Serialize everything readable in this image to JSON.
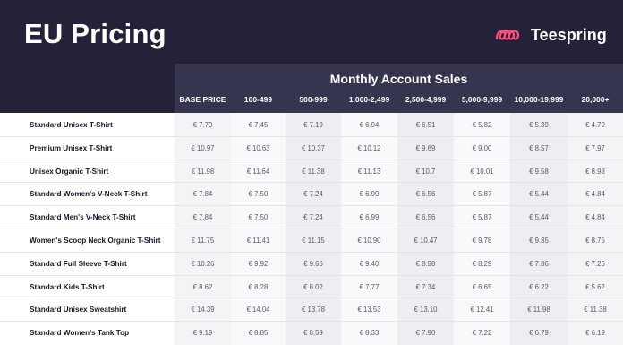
{
  "header": {
    "title": "EU Pricing",
    "brand": "Teespring"
  },
  "table": {
    "group_title": "Monthly Account Sales",
    "columns": [
      "BASE PRICE",
      "100-499",
      "500-999",
      "1,000-2,499",
      "2,500-4,999",
      "5,000-9,999",
      "10,000-19,999",
      "20,000+"
    ],
    "rows": [
      {
        "product": "Standard Unisex T-Shirt",
        "prices": [
          "€ 7.79",
          "€ 7.45",
          "€ 7.19",
          "€ 6.94",
          "€ 6.51",
          "€ 5.82",
          "€ 5.39",
          "€ 4.79"
        ]
      },
      {
        "product": "Premium Unisex T-Shirt",
        "prices": [
          "€ 10.97",
          "€ 10.63",
          "€ 10.37",
          "€ 10.12",
          "€ 9.69",
          "€ 9.00",
          "€ 8.57",
          "€ 7.97"
        ]
      },
      {
        "product": "Unisex Organic T-Shirt",
        "prices": [
          "€ 11.98",
          "€ 11.64",
          "€ 11.38",
          "€ 11.13",
          "€ 10.7",
          "€ 10.01",
          "€ 9.58",
          "€ 8.98"
        ]
      },
      {
        "product": "Standard Women's V-Neck T-Shirt",
        "prices": [
          "€ 7.84",
          "€ 7.50",
          "€ 7.24",
          "€ 6.99",
          "€ 6.56",
          "€ 5.87",
          "€ 5.44",
          "€ 4.84"
        ]
      },
      {
        "product": "Standard Men's V-Neck T-Shirt",
        "prices": [
          "€ 7.84",
          "€ 7.50",
          "€ 7.24",
          "€ 6.99",
          "€ 6.56",
          "€ 5.87",
          "€ 5.44",
          "€ 4.84"
        ]
      },
      {
        "product": "Women's Scoop Neck Organic T-Shirt",
        "prices": [
          "€ 11.75",
          "€ 11.41",
          "€ 11.15",
          "€ 10.90",
          "€ 10.47",
          "€ 9.78",
          "€ 9.35",
          "€ 8.75"
        ]
      },
      {
        "product": "Standard Full Sleeve T-Shirt",
        "prices": [
          "€ 10.26",
          "€ 9.92",
          "€ 9.66",
          "€ 9.40",
          "€ 8.98",
          "€ 8.29",
          "€ 7.86",
          "€ 7.26"
        ]
      },
      {
        "product": "Standard Kids T-Shirt",
        "prices": [
          "€ 8.62",
          "€ 8.28",
          "€ 8.02",
          "€ 7.77",
          "€ 7.34",
          "€ 6.65",
          "€ 6.22",
          "€ 5.62"
        ]
      },
      {
        "product": "Standard Unisex Sweatshirt",
        "prices": [
          "€ 14.39",
          "€ 14.04",
          "€ 13.78",
          "€ 13.53",
          "€ 13.10",
          "€ 12.41",
          "€ 11.98",
          "€ 11.38"
        ]
      },
      {
        "product": "Standard Women's Tank Top",
        "prices": [
          "€ 9.19",
          "€ 8.85",
          "€ 8.59",
          "€ 8.33",
          "€ 7.90",
          "€ 7.22",
          "€ 6.79",
          "€ 6.19"
        ]
      }
    ]
  },
  "colors": {
    "header_bg": "#232238",
    "panel_bg": "#363550",
    "brand_accent": "#ff4f7b"
  }
}
